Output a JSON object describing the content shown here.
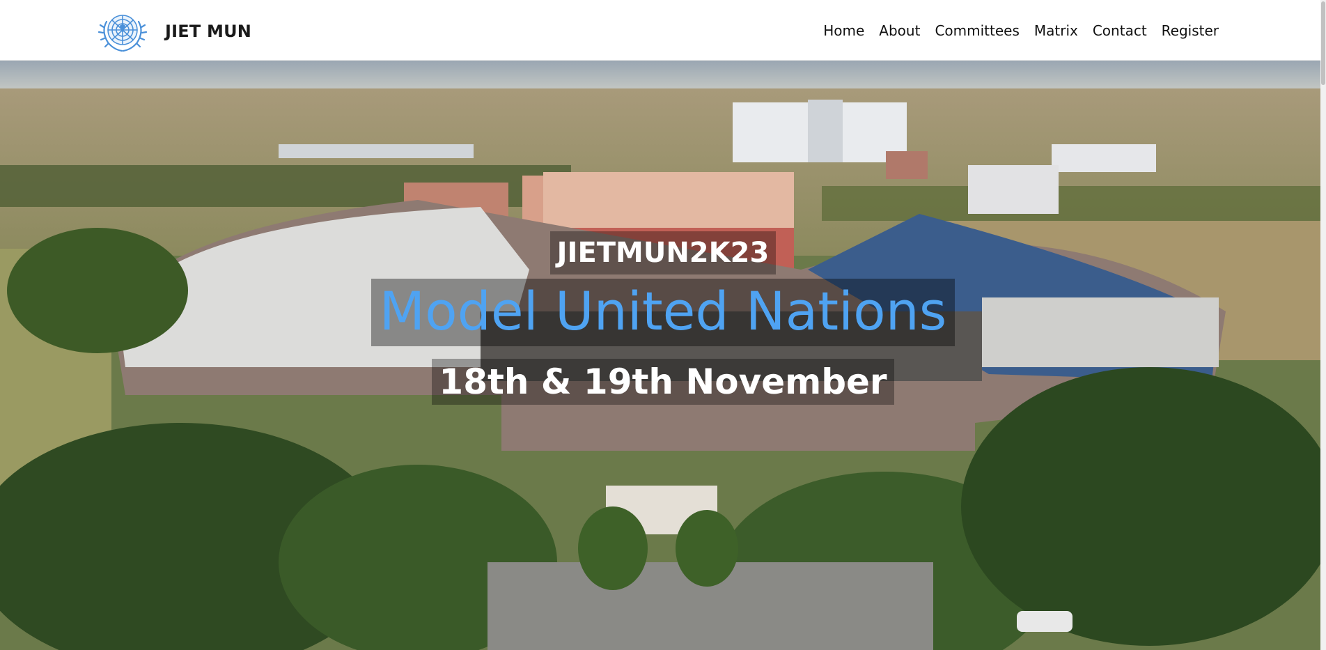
{
  "header": {
    "brand_name": "JIET MUN",
    "logo_icon": "un-emblem-icon",
    "nav": [
      {
        "label": "Home"
      },
      {
        "label": "About"
      },
      {
        "label": "Committees"
      },
      {
        "label": "Matrix"
      },
      {
        "label": "Contact"
      },
      {
        "label": "Register"
      }
    ]
  },
  "hero": {
    "tagline": "JIETMUN2K23",
    "title": "Model United Nations",
    "dates": "18th & 19th November",
    "background": "aerial-campus-photo",
    "title_color": "#4fa3f2"
  }
}
